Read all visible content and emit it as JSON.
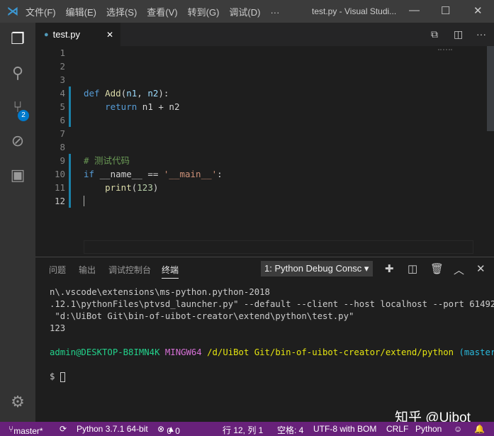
{
  "titlebar": {
    "menu": [
      "文件(F)",
      "编辑(E)",
      "选择(S)",
      "查看(V)",
      "转到(G)",
      "调试(D)",
      "···"
    ],
    "title": "test.py - Visual Studi..."
  },
  "activity": {
    "scm_badge": "2"
  },
  "tab": {
    "label": "test.py"
  },
  "editor": {
    "lines": [
      "1",
      "2",
      "3",
      "4",
      "5",
      "6",
      "7",
      "8",
      "9",
      "10",
      "11",
      "12"
    ],
    "code": {
      "def": "def",
      "fname": "Add",
      "open": "(",
      "p1": "n1",
      ", ": ", ",
      "p2": "n2",
      "close": "):",
      "ret": "return",
      "expr": " n1 + n2",
      "comment": "# 测试代码",
      "if": "if",
      "cond": " __name__ == ",
      "str": "'__main__'",
      "colon": ":",
      "print": "print",
      "num": "123"
    }
  },
  "panel": {
    "tabs": [
      "问题",
      "输出",
      "调试控制台",
      "终端"
    ],
    "select": "1: Python Debug Consc ▾",
    "terminal": [
      "n\\.vscode\\extensions\\ms-python.python-2018",
      ".12.1\\pythonFiles\\ptvsd_launcher.py\" --default --client --host localhost --port 61492",
      " \"d:\\UiBot Git\\bin-of-uibot-creator\\extend\\python\\test.py\"",
      "123"
    ],
    "prompt": {
      "user": "admin@DESKTOP-B8IMN4K",
      "env": "MINGW64",
      "path": "/d/UiBot Git/bin-of-uibot-creator/extend/python",
      "branch": "(master)"
    },
    "dollar": "$"
  },
  "status": {
    "branch": "master*",
    "python": "Python 3.7.1 64-bit",
    "errors": "0",
    "warnings": "0",
    "position": "行 12, 列 1",
    "spaces": "空格: 4",
    "encoding": "UTF-8 with BOM",
    "eol": "CRLF",
    "language": "Python"
  },
  "watermark": "知乎 @Uibot"
}
